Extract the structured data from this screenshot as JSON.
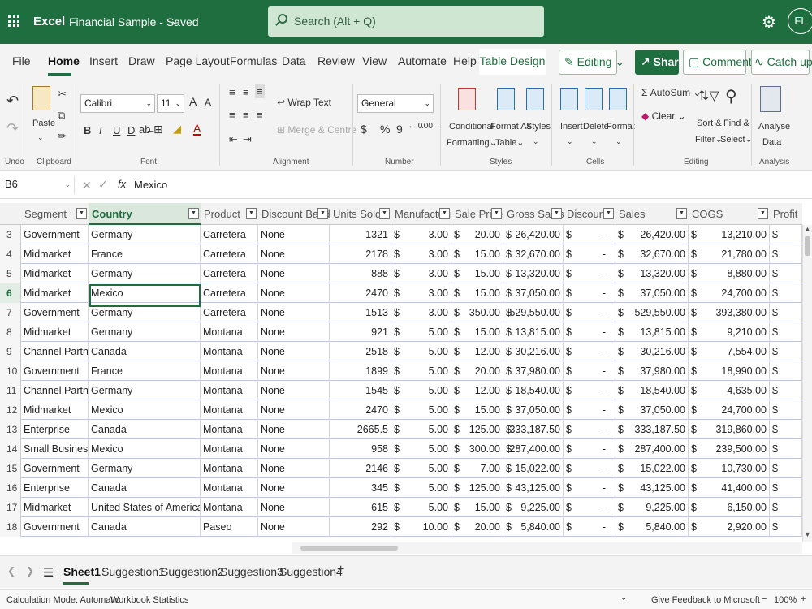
{
  "titlebar": {
    "app_name": "Excel",
    "doc_title": "Financial Sample - Saved",
    "search_placeholder": "Search (Alt + Q)",
    "avatar_initials": "FL"
  },
  "tabs": [
    "File",
    "Home",
    "Insert",
    "Draw",
    "Page Layout",
    "Formulas",
    "Data",
    "Review",
    "View",
    "Automate",
    "Help",
    "Table Design"
  ],
  "active_tab": "Home",
  "ribbon_right": {
    "editing": "Editing",
    "share": "Share",
    "comments": "Comments",
    "catch_up": "Catch up"
  },
  "ribbon": {
    "undo_label": "Undo",
    "clipboard": {
      "paste": "Paste",
      "label": "Clipboard"
    },
    "font": {
      "name": "Calibri",
      "size": "11",
      "grow": "A",
      "shrink": "A",
      "label": "Font",
      "bold": "B",
      "italic": "I",
      "underline": "U",
      "double_underline": "D"
    },
    "alignment": {
      "wrap": "Wrap Text",
      "merge": "Merge & Centre",
      "label": "Alignment"
    },
    "number": {
      "format": "General",
      "label": "Number",
      "currency": "$",
      "percent": "%",
      "comma": "9"
    },
    "styles": {
      "conditional": "Conditional",
      "formatting": "Formatting",
      "format_as": "Format As",
      "table": "Table",
      "cell_styles": "Styles",
      "label": "Styles"
    },
    "cells": {
      "insert": "Insert",
      "delete": "Delete",
      "format": "Format",
      "label": "Cells"
    },
    "editing": {
      "autosum": "AutoSum",
      "clear": "Clear",
      "sort": "Sort &",
      "filter": "Filter",
      "find": "Find &",
      "select": "Select",
      "label": "Editing"
    },
    "analysis": {
      "analyse": "Analyse",
      "data": "Data",
      "label": "Analysis"
    }
  },
  "formula_bar": {
    "name_box": "B6",
    "fx": "fx",
    "value": "Mexico"
  },
  "columns": [
    "Segment",
    "Country",
    "Product",
    "Discount Band",
    "Units Sold",
    "Manufacturing",
    "Sale Price",
    "Gross Sales",
    "Discounts",
    "Sales",
    "COGS",
    "Profit"
  ],
  "rows": [
    {
      "n": "3",
      "segment": "Government",
      "country": "Germany",
      "product": "Carretera",
      "band": "None",
      "units": "1321",
      "mfg": "3.00",
      "price": "20.00",
      "gross": "26,420.00",
      "disc": "-",
      "sales": "26,420.00",
      "cogs": "13,210.00"
    },
    {
      "n": "4",
      "segment": "Midmarket",
      "country": "France",
      "product": "Carretera",
      "band": "None",
      "units": "2178",
      "mfg": "3.00",
      "price": "15.00",
      "gross": "32,670.00",
      "disc": "-",
      "sales": "32,670.00",
      "cogs": "21,780.00"
    },
    {
      "n": "5",
      "segment": "Midmarket",
      "country": "Germany",
      "product": "Carretera",
      "band": "None",
      "units": "888",
      "mfg": "3.00",
      "price": "15.00",
      "gross": "13,320.00",
      "disc": "-",
      "sales": "13,320.00",
      "cogs": "8,880.00"
    },
    {
      "n": "6",
      "segment": "Midmarket",
      "country": "Mexico",
      "product": "Carretera",
      "band": "None",
      "units": "2470",
      "mfg": "3.00",
      "price": "15.00",
      "gross": "37,050.00",
      "disc": "-",
      "sales": "37,050.00",
      "cogs": "24,700.00"
    },
    {
      "n": "7",
      "segment": "Government",
      "country": "Germany",
      "product": "Carretera",
      "band": "None",
      "units": "1513",
      "mfg": "3.00",
      "price": "350.00",
      "gross": "529,550.00",
      "disc": "-",
      "sales": "529,550.00",
      "cogs": "393,380.00"
    },
    {
      "n": "8",
      "segment": "Midmarket",
      "country": "Germany",
      "product": "Montana",
      "band": "None",
      "units": "921",
      "mfg": "5.00",
      "price": "15.00",
      "gross": "13,815.00",
      "disc": "-",
      "sales": "13,815.00",
      "cogs": "9,210.00"
    },
    {
      "n": "9",
      "segment": "Channel Partners",
      "country": "Canada",
      "product": "Montana",
      "band": "None",
      "units": "2518",
      "mfg": "5.00",
      "price": "12.00",
      "gross": "30,216.00",
      "disc": "-",
      "sales": "30,216.00",
      "cogs": "7,554.00"
    },
    {
      "n": "10",
      "segment": "Government",
      "country": "France",
      "product": "Montana",
      "band": "None",
      "units": "1899",
      "mfg": "5.00",
      "price": "20.00",
      "gross": "37,980.00",
      "disc": "-",
      "sales": "37,980.00",
      "cogs": "18,990.00"
    },
    {
      "n": "11",
      "segment": "Channel Partners",
      "country": "Germany",
      "product": "Montana",
      "band": "None",
      "units": "1545",
      "mfg": "5.00",
      "price": "12.00",
      "gross": "18,540.00",
      "disc": "-",
      "sales": "18,540.00",
      "cogs": "4,635.00"
    },
    {
      "n": "12",
      "segment": "Midmarket",
      "country": "Mexico",
      "product": "Montana",
      "band": "None",
      "units": "2470",
      "mfg": "5.00",
      "price": "15.00",
      "gross": "37,050.00",
      "disc": "-",
      "sales": "37,050.00",
      "cogs": "24,700.00"
    },
    {
      "n": "13",
      "segment": "Enterprise",
      "country": "Canada",
      "product": "Montana",
      "band": "None",
      "units": "2665.5",
      "mfg": "5.00",
      "price": "125.00",
      "gross": "333,187.50",
      "disc": "-",
      "sales": "333,187.50",
      "cogs": "319,860.00"
    },
    {
      "n": "14",
      "segment": "Small Business",
      "country": "Mexico",
      "product": "Montana",
      "band": "None",
      "units": "958",
      "mfg": "5.00",
      "price": "300.00",
      "gross": "287,400.00",
      "disc": "-",
      "sales": "287,400.00",
      "cogs": "239,500.00"
    },
    {
      "n": "15",
      "segment": "Government",
      "country": "Germany",
      "product": "Montana",
      "band": "None",
      "units": "2146",
      "mfg": "5.00",
      "price": "7.00",
      "gross": "15,022.00",
      "disc": "-",
      "sales": "15,022.00",
      "cogs": "10,730.00"
    },
    {
      "n": "16",
      "segment": "Enterprise",
      "country": "Canada",
      "product": "Montana",
      "band": "None",
      "units": "345",
      "mfg": "5.00",
      "price": "125.00",
      "gross": "43,125.00",
      "disc": "-",
      "sales": "43,125.00",
      "cogs": "41,400.00"
    },
    {
      "n": "17",
      "segment": "Midmarket",
      "country": "United States of America",
      "product": "Montana",
      "band": "None",
      "units": "615",
      "mfg": "5.00",
      "price": "15.00",
      "gross": "9,225.00",
      "disc": "-",
      "sales": "9,225.00",
      "cogs": "6,150.00"
    },
    {
      "n": "18",
      "segment": "Government",
      "country": "Canada",
      "product": "Paseo",
      "band": "None",
      "units": "292",
      "mfg": "10.00",
      "price": "20.00",
      "gross": "5,840.00",
      "disc": "-",
      "sales": "5,840.00",
      "cogs": "2,920.00"
    }
  ],
  "currency_symbol": "$",
  "selected_row": "6",
  "sheets": [
    "Sheet1",
    "Suggestion1",
    "Suggestion2",
    "Suggestion3",
    "Suggestion4"
  ],
  "active_sheet": "Sheet1",
  "add_sheet": "+",
  "status": {
    "calc_mode": "Calculation Mode: Automatic",
    "workbook_stats": "Workbook Statistics",
    "feedback": "Give Feedback to Microsoft",
    "zoom": "100%",
    "zoom_minus": "−",
    "zoom_plus": "+"
  },
  "colors": {
    "brand": "#1e6e3f",
    "search_bg": "#cfe6d3",
    "grid_line": "#bcc8e0"
  }
}
